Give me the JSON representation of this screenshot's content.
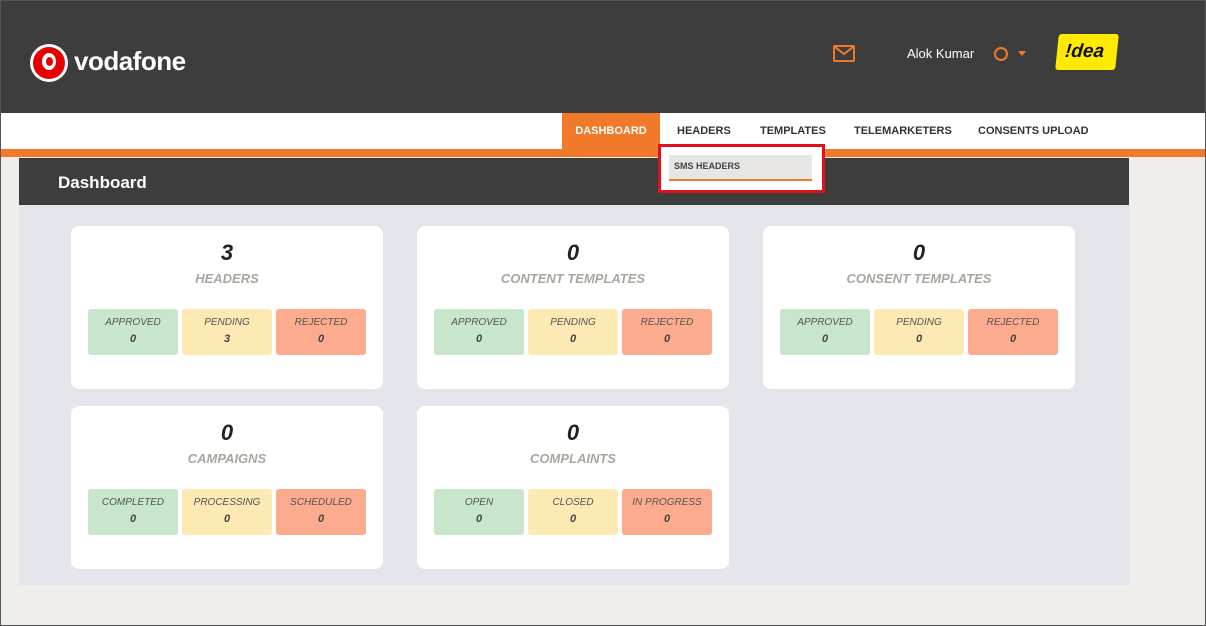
{
  "header": {
    "brand": "vodafone",
    "user_name": "Alok Kumar",
    "partner_logo_text": "!dea"
  },
  "nav": {
    "items": [
      "DASHBOARD",
      "HEADERS",
      "TEMPLATES",
      "TELEMARKETERS",
      "CONSENTS UPLOAD"
    ],
    "active": "DASHBOARD"
  },
  "dropdown": {
    "items": [
      "SMS HEADERS"
    ]
  },
  "page": {
    "title": "Dashboard"
  },
  "cards": [
    {
      "count": "3",
      "label": "HEADERS",
      "stats": [
        {
          "label": "APPROVED",
          "value": "0"
        },
        {
          "label": "PENDING",
          "value": "3"
        },
        {
          "label": "REJECTED",
          "value": "0"
        }
      ]
    },
    {
      "count": "0",
      "label": "CONTENT TEMPLATES",
      "stats": [
        {
          "label": "APPROVED",
          "value": "0"
        },
        {
          "label": "PENDING",
          "value": "0"
        },
        {
          "label": "REJECTED",
          "value": "0"
        }
      ]
    },
    {
      "count": "0",
      "label": "CONSENT TEMPLATES",
      "stats": [
        {
          "label": "APPROVED",
          "value": "0"
        },
        {
          "label": "PENDING",
          "value": "0"
        },
        {
          "label": "REJECTED",
          "value": "0"
        }
      ]
    },
    {
      "count": "0",
      "label": "CAMPAIGNS",
      "stats": [
        {
          "label": "COMPLETED",
          "value": "0"
        },
        {
          "label": "PROCESSING",
          "value": "0"
        },
        {
          "label": "SCHEDULED",
          "value": "0"
        }
      ]
    },
    {
      "count": "0",
      "label": "COMPLAINTS",
      "stats": [
        {
          "label": "OPEN",
          "value": "0"
        },
        {
          "label": "CLOSED",
          "value": "0"
        },
        {
          "label": "IN PROGRESS",
          "value": "0"
        }
      ]
    }
  ],
  "icons": {
    "mail": "mail-icon",
    "user": "user-circle-icon",
    "caret": "caret-down-icon"
  },
  "colors": {
    "accent": "#f07a2a",
    "header_bg": "#3d3d3d",
    "highlight": "#e0101d",
    "green": "#c7e6cc",
    "yellow": "#fde9b3",
    "red": "#fcab8e"
  }
}
